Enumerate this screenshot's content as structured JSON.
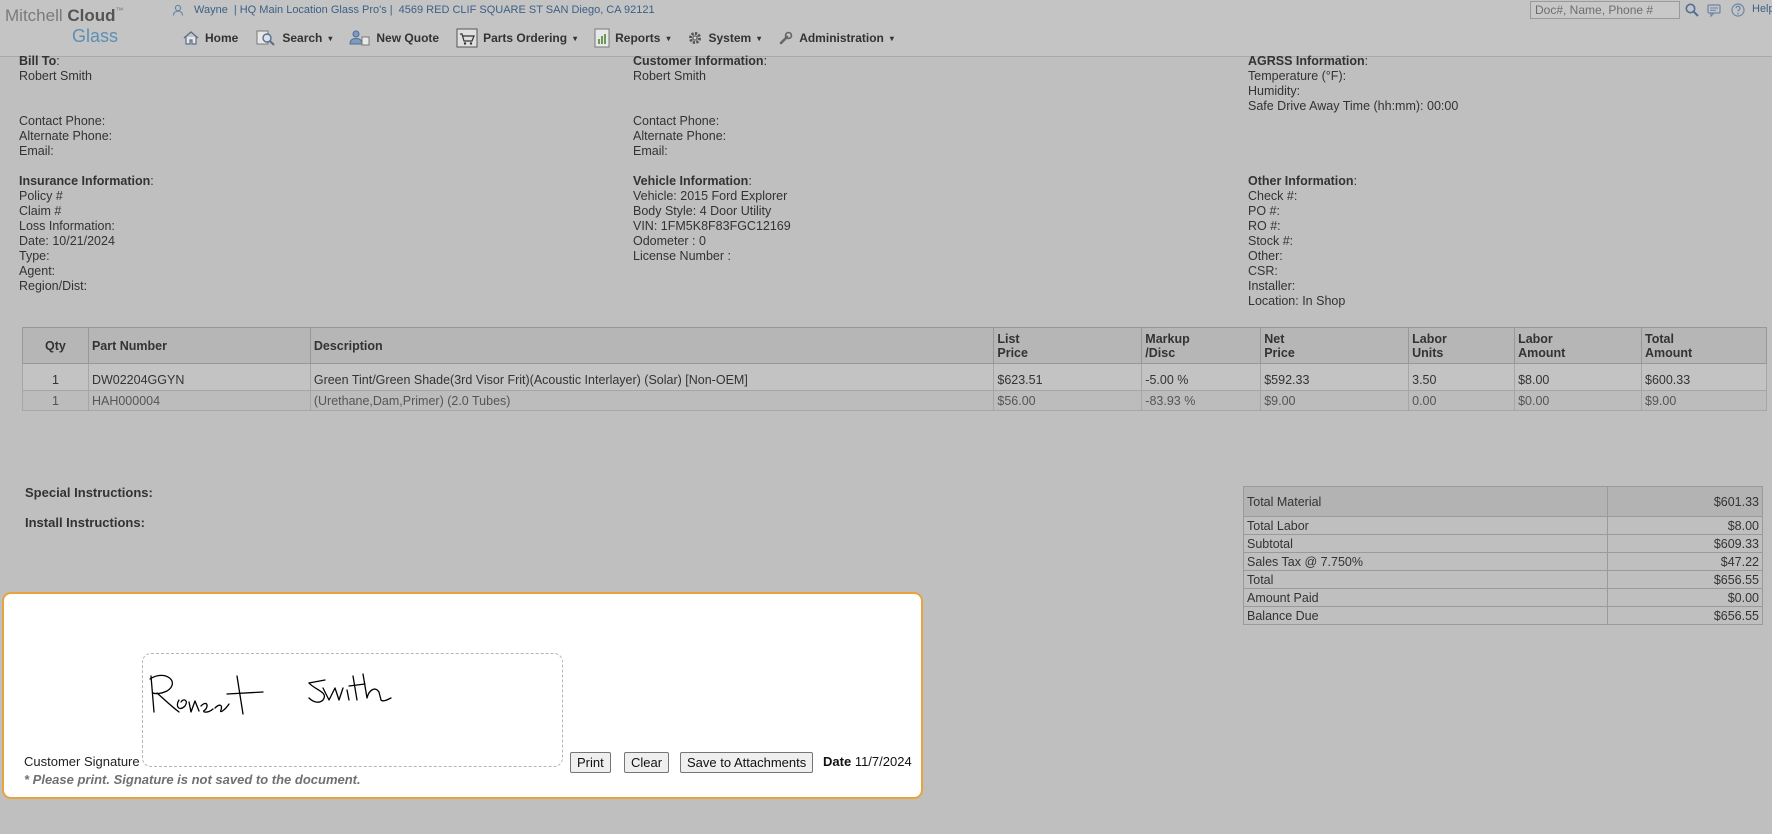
{
  "brand": {
    "name_part1": "Mitchell ",
    "name_part2": "Cloud",
    "trademark": "™",
    "product": "Glass"
  },
  "header": {
    "user": "Wayne",
    "location": "| HQ Main Location Glass Pro's |",
    "address": "4569 RED CLIF SQUARE ST SAN Diego, CA 92121",
    "search_placeholder": "Doc#, Name, Phone #",
    "help_label": "Help"
  },
  "nav": {
    "home": "Home",
    "search": "Search",
    "new_quote": "New Quote",
    "parts_ordering": "Parts Ordering",
    "reports": "Reports",
    "system": "System",
    "administration": "Administration",
    "caret": "▾"
  },
  "bill_to": {
    "heading": "Bill To",
    "colon": ":",
    "name": "Robert Smith",
    "contact_phone": "Contact Phone:",
    "alternate_phone": "Alternate Phone:",
    "email": "Email:"
  },
  "customer": {
    "heading": "Customer Information",
    "colon": ":",
    "name": "Robert Smith",
    "contact_phone": "Contact Phone:",
    "alternate_phone": "Alternate Phone:",
    "email": "Email:"
  },
  "agrss": {
    "heading": "AGRSS Information",
    "colon": ":",
    "temperature": "Temperature (°F):",
    "humidity": "Humidity:",
    "safe_drive": "Safe Drive Away Time (hh:mm): 00:00"
  },
  "insurance": {
    "heading": "Insurance Information",
    "colon": ":",
    "policy": "Policy #",
    "claim": "Claim #",
    "loss": "Loss Information:",
    "date": "Date: 10/21/2024",
    "type": "Type:",
    "agent": "Agent:",
    "region": "Region/Dist:"
  },
  "vehicle": {
    "heading": "Vehicle Information",
    "colon": ":",
    "vehicle": "Vehicle: 2015  Ford  Explorer",
    "body": "Body Style: 4 Door Utility",
    "vin": "VIN: 1FM5K8F83FGC12169",
    "odometer": "Odometer : 0",
    "license": "License Number :"
  },
  "other": {
    "heading": "Other Information",
    "colon": ":",
    "check": "Check #:",
    "po": "PO #:",
    "ro": "RO #:",
    "stock": "Stock #:",
    "other": "Other:",
    "csr": "CSR:",
    "installer": "Installer:",
    "location": "Location: In Shop"
  },
  "parts_table": {
    "headers": {
      "qty": "Qty",
      "part_number": "Part Number",
      "description": "Description",
      "list_price_1": "List",
      "list_price_2": "Price",
      "markup_1": "Markup",
      "markup_2": "/Disc",
      "net_price_1": "Net",
      "net_price_2": "Price",
      "labor_units_1": "Labor",
      "labor_units_2": "Units",
      "labor_amount_1": "Labor",
      "labor_amount_2": "Amount",
      "total_amount_1": "Total",
      "total_amount_2": "Amount"
    },
    "rows": [
      {
        "qty": "1",
        "part_number": "DW02204GGYN",
        "description": "Green Tint/Green Shade(3rd Visor Frit)(Acoustic Interlayer) (Solar) [Non-OEM]",
        "list_price": "$623.51",
        "markup": "-5.00 %",
        "net_price": "$592.33",
        "labor_units": "3.50",
        "labor_amount": "$8.00",
        "total_amount": "$600.33"
      },
      {
        "qty": "1",
        "part_number": "HAH000004",
        "description": "(Urethane,Dam,Primer) (2.0 Tubes)",
        "list_price": "$56.00",
        "markup": "-83.93 %",
        "net_price": "$9.00",
        "labor_units": "0.00",
        "labor_amount": "$0.00",
        "total_amount": "$9.00"
      }
    ]
  },
  "instructions": {
    "special": "Special Instructions:",
    "install": "Install Instructions:"
  },
  "totals": [
    {
      "label": "Total Material",
      "value": "$601.33"
    },
    {
      "label": "Total Labor",
      "value": "$8.00"
    },
    {
      "label": "Subtotal",
      "value": "$609.33"
    },
    {
      "label": "Sales Tax @ 7.750%",
      "value": "$47.22"
    },
    {
      "label": "Total",
      "value": "$656.55"
    },
    {
      "label": "Amount Paid",
      "value": "$0.00"
    },
    {
      "label": "Balance Due",
      "value": "$656.55"
    }
  ],
  "signature": {
    "label": "Customer Signature",
    "note": "* Please print. Signature is not saved to the document.",
    "print_button": "Print",
    "clear_button": "Clear",
    "save_button": "Save to Attachments",
    "date_label": "Date",
    "date_value": "11/7/2024"
  },
  "colors": {
    "page_bg": "#bfbfbf",
    "link_blue": "#3d5f86",
    "brand_blue": "#5d8fb3",
    "panel_border": "#e8a33d"
  }
}
